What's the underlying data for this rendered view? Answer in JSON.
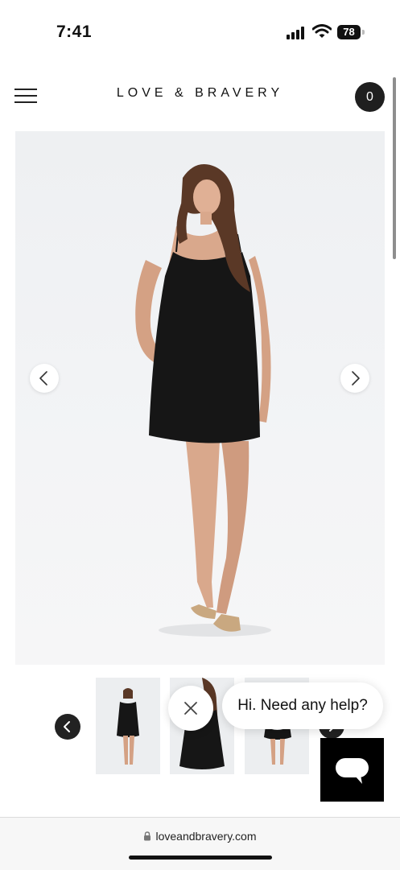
{
  "status_bar": {
    "time": "7:41",
    "battery": "78"
  },
  "header": {
    "brand": "LOVE & BRAVERY",
    "cart_count": "0"
  },
  "chat": {
    "prompt": "Hi. Need any help?"
  },
  "browser": {
    "url": "loveandbravery.com"
  },
  "icons": {
    "menu": "hamburger-icon",
    "prev": "chevron-left-icon",
    "next": "chevron-right-icon",
    "close": "close-icon",
    "chat": "chat-bubble-icon",
    "lock": "lock-icon"
  },
  "colors": {
    "accent": "#1f1f1f",
    "background": "#ffffff",
    "chat_launcher": "#000000"
  }
}
